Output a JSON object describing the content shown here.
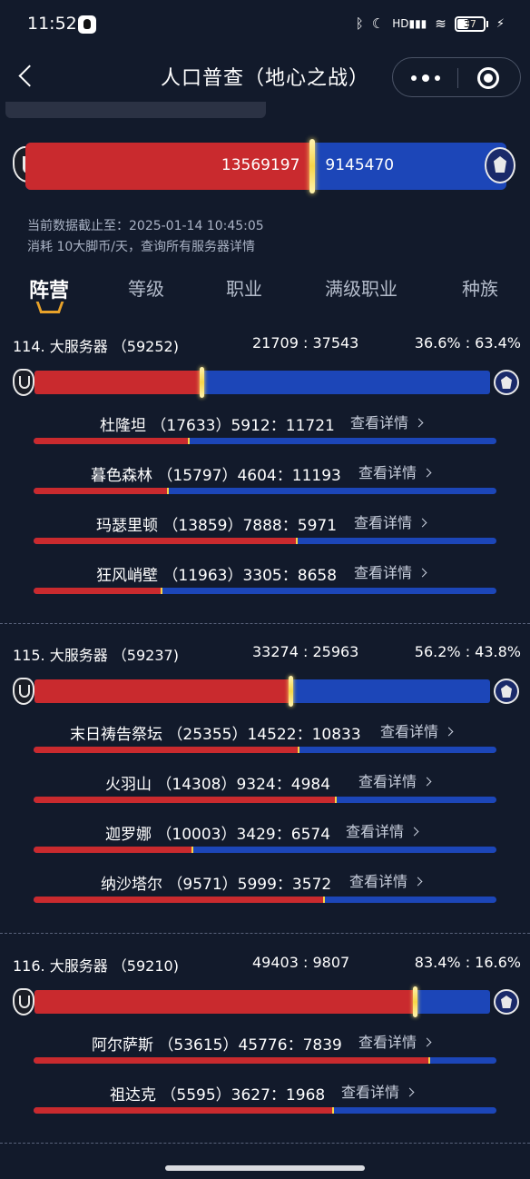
{
  "status_bar": {
    "time": "11:52",
    "icons": [
      "qq-icon",
      "bluetooth-icon",
      "moon-icon",
      "hd-signal-icon",
      "wifi-icon"
    ],
    "battery": "37"
  },
  "nav": {
    "title": "人口普查（地心之战）"
  },
  "totals": {
    "horde": "13569197",
    "alliance": "9145470",
    "horde_fraction": 0.597
  },
  "meta": {
    "updated": "当前数据截止至：2025-01-14 10:45:05",
    "cost": "消耗 10大脚币/天，查询所有服务器详情"
  },
  "tabs": [
    {
      "label": "阵营",
      "active": true
    },
    {
      "label": "等级",
      "active": false
    },
    {
      "label": "职业",
      "active": false
    },
    {
      "label": "满级职业",
      "active": false
    },
    {
      "label": "种族",
      "active": false
    }
  ],
  "detail_label": "查看详情",
  "regions": [
    {
      "name": "114. 大服务器 （59252)",
      "ratio": "21709 : 37543",
      "pct": "36.6% : 63.4%",
      "horde_fraction": 0.366,
      "servers": [
        {
          "label": "杜隆坦 （17633）5912：11721",
          "horde_fraction": 0.335
        },
        {
          "label": "暮色森林 （15797）4604：11193",
          "horde_fraction": 0.291
        },
        {
          "label": "玛瑟里顿 （13859）7888：5971",
          "horde_fraction": 0.569
        },
        {
          "label": "狂风峭壁 （11963）3305：8658",
          "horde_fraction": 0.276
        }
      ]
    },
    {
      "name": "115. 大服务器 （59237)",
      "ratio": "33274 : 25963",
      "pct": "56.2% : 43.8%",
      "horde_fraction": 0.562,
      "servers": [
        {
          "label": "末日祷告祭坛 （25355）14522：10833",
          "horde_fraction": 0.573
        },
        {
          "label": "火羽山 （14308）9324：4984",
          "horde_fraction": 0.652
        },
        {
          "label": "迦罗娜 （10003）3429：6574",
          "horde_fraction": 0.343
        },
        {
          "label": "纳沙塔尔 （9571）5999：3572",
          "horde_fraction": 0.627
        }
      ]
    },
    {
      "name": "116. 大服务器 （59210)",
      "ratio": "49403 : 9807",
      "pct": "83.4% : 16.6%",
      "horde_fraction": 0.834,
      "servers": [
        {
          "label": "阿尔萨斯 （53615）45776：7839",
          "horde_fraction": 0.854
        },
        {
          "label": "祖达克 （5595）3627：1968",
          "horde_fraction": 0.648
        }
      ]
    }
  ],
  "colors": {
    "horde": "#c92a2e",
    "alliance": "#1c46b8",
    "accent": "#e8a22a",
    "background": "#121a2b"
  }
}
